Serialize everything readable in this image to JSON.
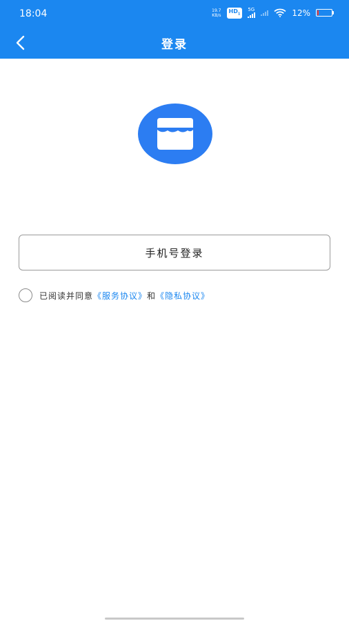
{
  "status_bar": {
    "time": "18:04",
    "net_speed_value": "19.7",
    "net_speed_unit": "KB/s",
    "hd_label": "HD",
    "hd_sub": "1",
    "network_type": "5G",
    "network_sub": "1",
    "battery_percent": "12%",
    "battery_level": 0.12
  },
  "header": {
    "title": "登录",
    "back_icon": "chevron-left-icon",
    "background_color": "#1b87f0"
  },
  "logo": {
    "icon": "shop-box-icon",
    "color": "#2c7df2"
  },
  "login_button": {
    "label": "手机号登录"
  },
  "agreement": {
    "checked": false,
    "prefix": "已阅读并同意",
    "service_link": "《服务协议》",
    "conjunction": "和",
    "privacy_link": "《隐私协议》",
    "link_color": "#1b87f0"
  }
}
